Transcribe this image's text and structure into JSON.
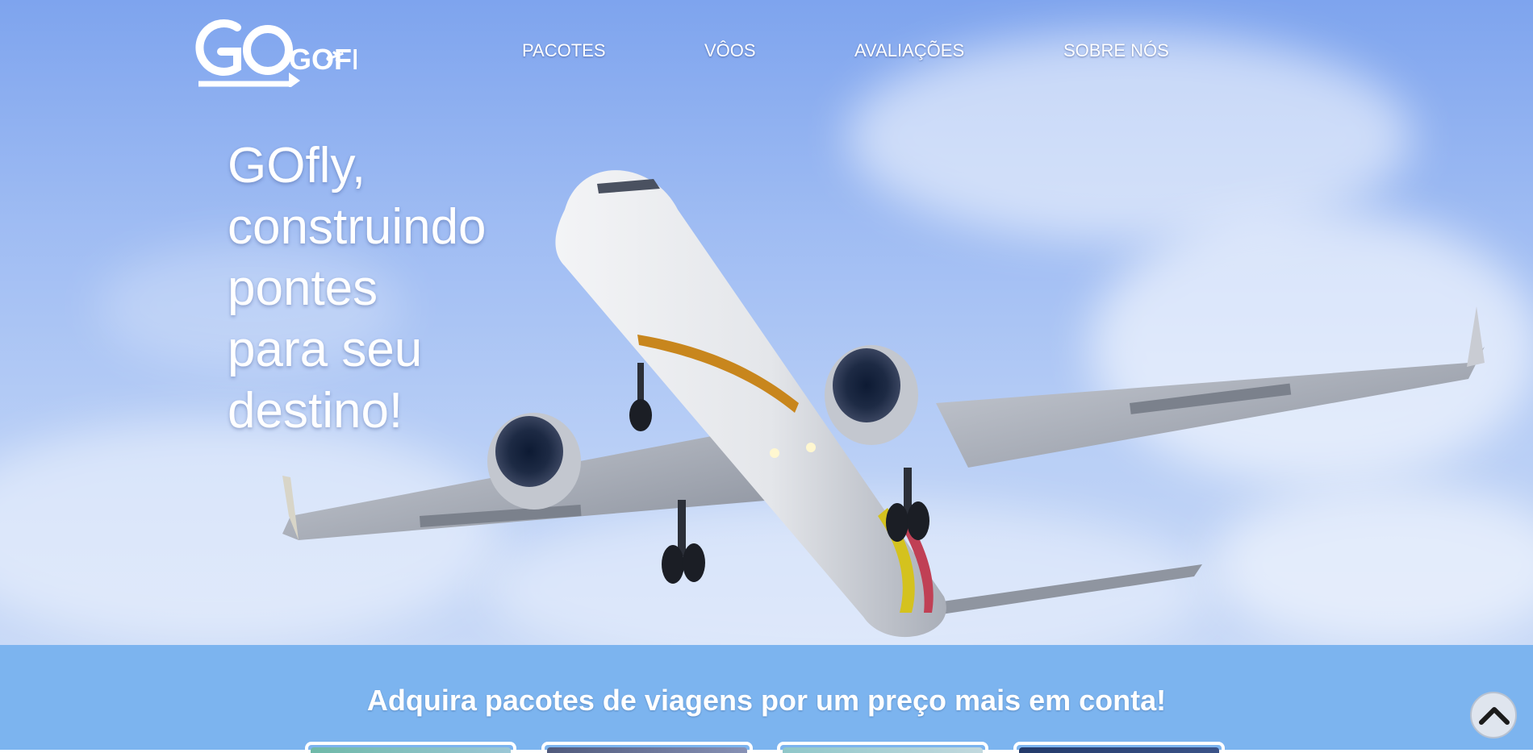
{
  "brand": {
    "logo_text": "GOFLY",
    "logo_icon": "airplane-icon"
  },
  "nav": {
    "items": [
      {
        "label": "PACOTES"
      },
      {
        "label": "VÔOS"
      },
      {
        "label": "AVALIAÇÕES"
      },
      {
        "label": "SOBRE NÓS"
      }
    ]
  },
  "hero": {
    "headline_lines": [
      "GOfly,",
      "construindo",
      "pontes",
      "para seu",
      "destino!"
    ],
    "image": "airplane-photo"
  },
  "packages": {
    "title": "Adquira pacotes de viagens por um preço mais em conta!"
  },
  "scroll_top": {
    "icon": "chevron-up-icon"
  },
  "colors": {
    "sky_top": "#7ea4ee",
    "band": "#7cb4ef",
    "text": "#ffffff"
  }
}
